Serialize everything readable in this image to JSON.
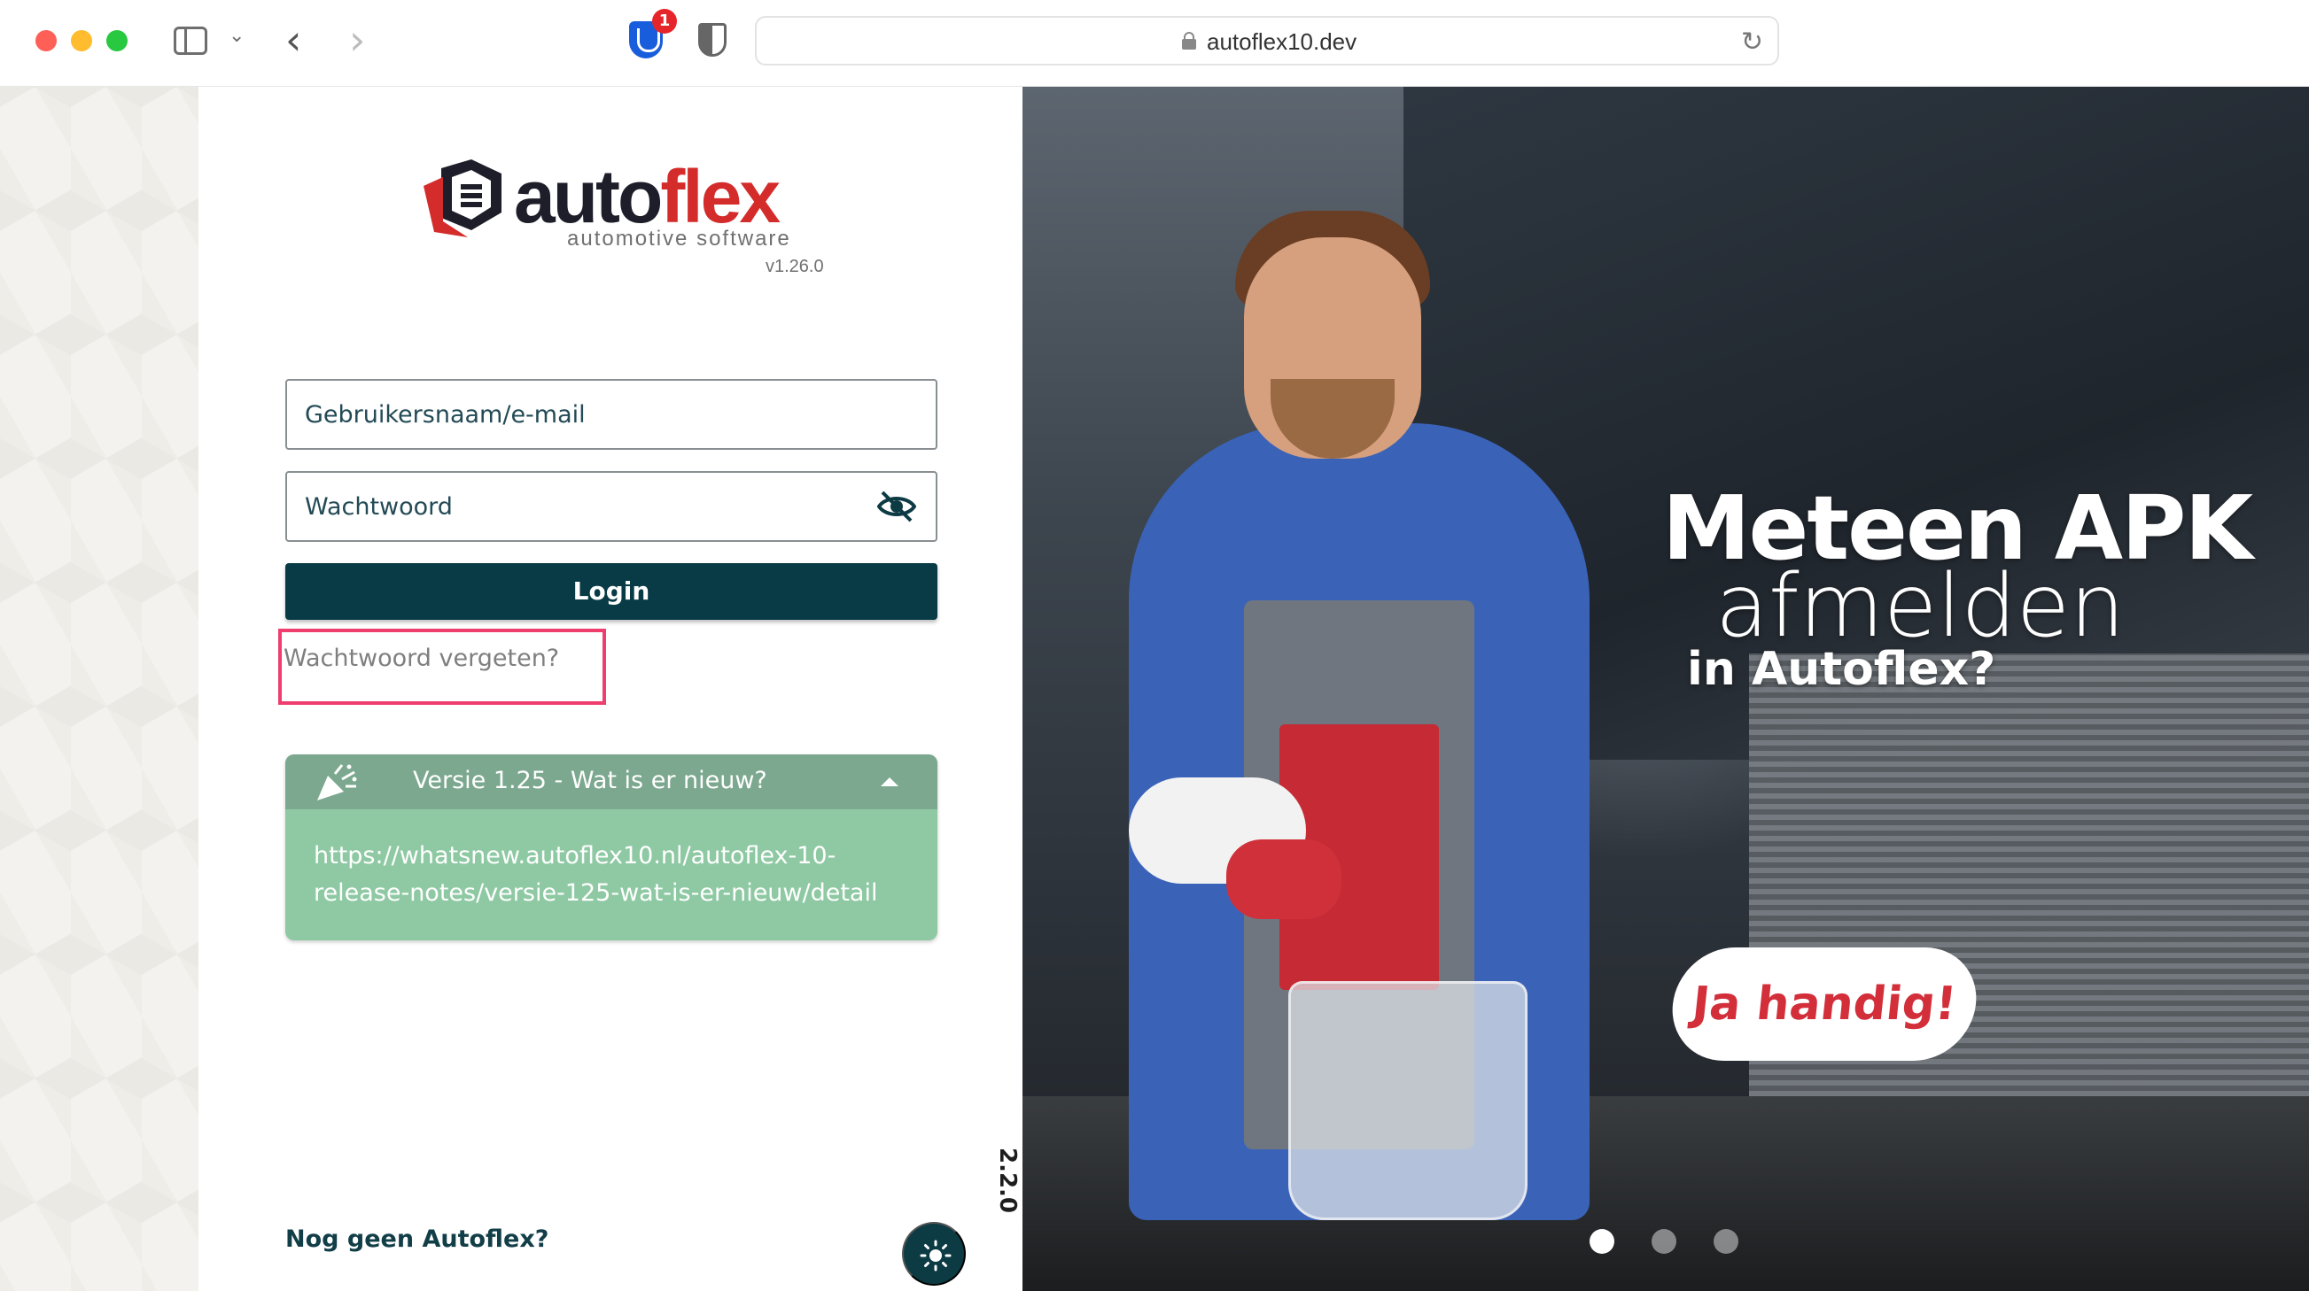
{
  "browser": {
    "url": "autoflex10.dev",
    "extension_badge": "1"
  },
  "logo": {
    "word_auto": "auto",
    "word_flex": "flex",
    "tagline": "automotive software",
    "version": "v1.26.0"
  },
  "login": {
    "username_placeholder": "Gebruikersnaam/e-mail",
    "password_placeholder": "Wachtwoord",
    "login_label": "Login",
    "forgot_label": "Wachtwoord vergeten?"
  },
  "news": {
    "title": "Versie 1.25 - Wat is er nieuw?",
    "link": "https://whatsnew.autoflex10.nl/autoflex-10-release-notes/versie-125-wat-is-er-nieuw/detail"
  },
  "footer": {
    "no_account": "Nog geen Autoflex?",
    "version_label": "Versie: 2.2.0"
  },
  "hero": {
    "line1": "Meteen APK",
    "line2": "afmelden",
    "line3": "in Autoflex?",
    "cta": "Ja handig!",
    "slide_count": 3,
    "active_slide": 1
  },
  "colors": {
    "primary": "#083b45",
    "accent_red": "#d42b2b",
    "news_green": "#8ec9a3",
    "highlight": "#ef3e6d"
  }
}
